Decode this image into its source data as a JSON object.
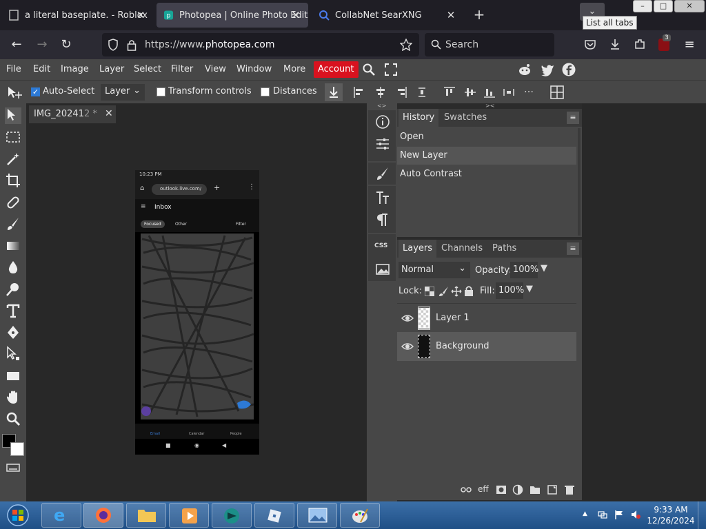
{
  "browser": {
    "tabs": [
      {
        "title": "a literal baseplate. - Roblox",
        "active": false
      },
      {
        "title": "Photopea | Online Photo Editor",
        "active": true
      },
      {
        "title": "CollabNet SearXNG",
        "active": false
      }
    ],
    "tooltip": "List all tabs",
    "url_prefix": "https://www.",
    "url_domain": "photopea.com",
    "search_placeholder": "Search",
    "extension_badge": "3"
  },
  "menu": [
    "File",
    "Edit",
    "Image",
    "Layer",
    "Select",
    "Filter",
    "View",
    "Window",
    "More"
  ],
  "account_label": "Account",
  "options": {
    "auto_select_label": "Auto-Select",
    "auto_select_checked": true,
    "layer_mode": "Layer",
    "transform_label": "Transform controls",
    "distances_label": "Distances"
  },
  "document_tab": {
    "name": "IMG_20241",
    "suffix": "2 *"
  },
  "phone": {
    "time": "10:23 PM",
    "url": "outlook.live.com/",
    "inbox": "Inbox",
    "focused": "Focused",
    "other": "Other",
    "filter": "Filter",
    "nav": [
      "Email",
      "Calendar",
      "People"
    ]
  },
  "history": {
    "tabs": [
      "History",
      "Swatches"
    ],
    "rows": [
      "Open",
      "New Layer",
      "Auto Contrast"
    ],
    "selected_index": 1
  },
  "layers": {
    "tabs": [
      "Layers",
      "Channels",
      "Paths"
    ],
    "blend_mode": "Normal",
    "opacity_label": "Opacity:",
    "opacity_value": "100%",
    "lock_label": "Lock:",
    "fill_label": "Fill:",
    "fill_value": "100%",
    "rows": [
      {
        "name": "Layer 1",
        "selected": false
      },
      {
        "name": "Background",
        "selected": true
      }
    ]
  },
  "side_strip": {
    "css_label": "CSS"
  },
  "taskbar": {
    "time": "9:33 AM",
    "date": "12/26/2024"
  },
  "colors": {
    "accent_red": "#d9121f",
    "panel": "#474747",
    "workspace": "#282828",
    "check_blue": "#2d7ad6"
  }
}
